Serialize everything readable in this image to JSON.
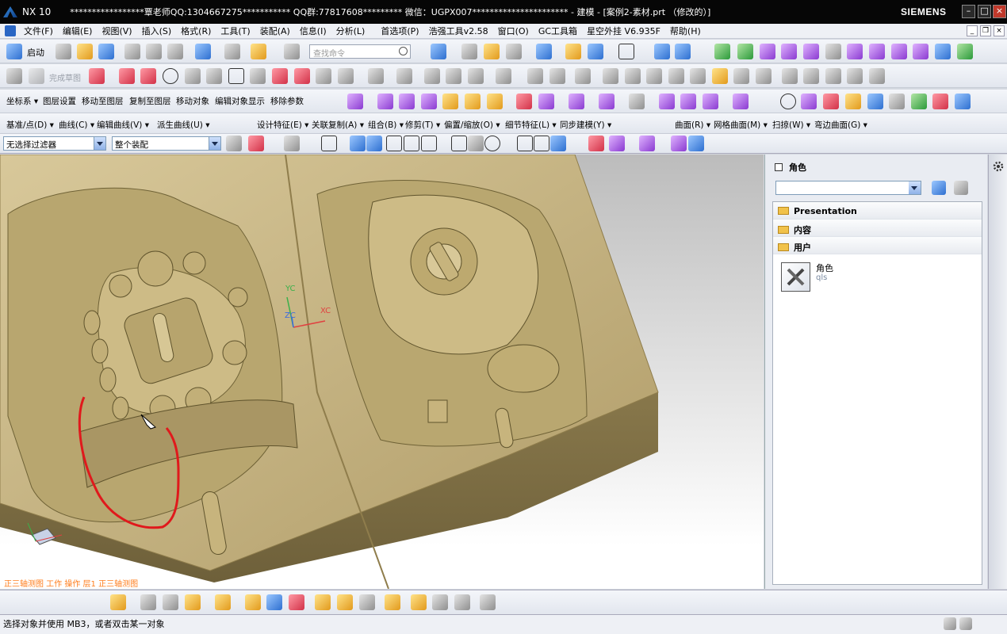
{
  "titlebar": {
    "app": "NX 10",
    "window_title": "*****************覃老师QQ:1304667275*********** QQ群:77817608********* 微信：UGPX007********************** - 建模 - [案例2-素材.prt （修改的）]",
    "brand": "SIEMENS"
  },
  "menu": {
    "items": [
      "文件(F)",
      "编辑(E)",
      "视图(V)",
      "插入(S)",
      "格式(R)",
      "工具(T)",
      "装配(A)",
      "信息(I)",
      "分析(L)",
      "首选项(P)",
      "浩强工具v2.58",
      "窗口(O)",
      "GC工具箱",
      "星空外挂 V6.935F",
      "帮助(H)"
    ]
  },
  "toolbar1": {
    "start_label": "启动",
    "search_placeholder": "查找命令"
  },
  "toolbar2": {
    "finish_sketch": "完成草图"
  },
  "menurow3": {
    "items": [
      "坐标系 ▾",
      "图层设置",
      "移动至图层",
      "复制至图层",
      "移动对象",
      "编辑对象显示",
      "移除参数"
    ]
  },
  "menurow4": {
    "items": [
      "基准/点(D) ▾",
      "曲线(C) ▾",
      "编辑曲线(V) ▾",
      "派生曲线(U) ▾",
      "设计特征(E) ▾",
      "关联复制(A) ▾",
      "组合(B) ▾",
      "修剪(T) ▾",
      "偏置/缩放(O) ▾",
      "细节特征(L) ▾",
      "同步建模(Y) ▾",
      "曲面(R) ▾",
      "网格曲面(M) ▾",
      "扫掠(W) ▾",
      "弯边曲面(G) ▾"
    ]
  },
  "filter": {
    "type_filter": "无选择过滤器",
    "scope": "整个装配"
  },
  "viewport": {
    "label": "正三轴测图 工作 操作 层1 正三轴测图",
    "axis_yc": "YC",
    "axis_xc": "XC",
    "axis_zc": "ZC",
    "model_color": "#c9b78a",
    "annotation_color": "#e0191c"
  },
  "role_panel": {
    "title": "角色",
    "sections": [
      "Presentation",
      "内容",
      "用户"
    ],
    "role_name": "角色",
    "role_sub": "qls"
  },
  "status": {
    "message": "选择对象并使用 MB3，或者双击某一对象"
  }
}
